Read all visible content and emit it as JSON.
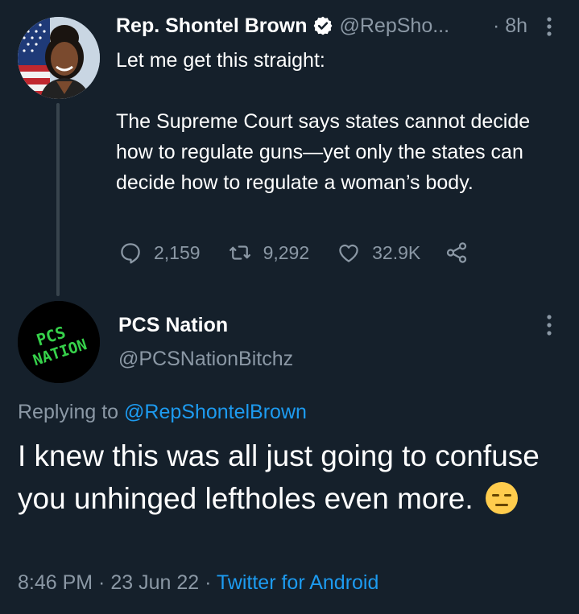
{
  "tweet1": {
    "author_name": "Rep. Shontel Brown",
    "handle": "@RepSho...",
    "time": "8h",
    "paragraphs": [
      "Let me get this straight:",
      "The Supreme Court says states cannot decide how to regulate guns—yet only the states can decide how to regulate a woman’s body."
    ],
    "replies": "2,159",
    "retweets": "9,292",
    "likes": "32.9K"
  },
  "tweet2": {
    "author_name": "PCS Nation",
    "handle": "@PCSNationBitchz",
    "avatar_text": [
      "PCS",
      "NATION"
    ],
    "replying_prefix": "Replying to",
    "replying_handle": "@RepShontelBrown",
    "text": "I knew this was all just going to confuse you unhinged leftholes even more.",
    "timestamp": "8:46 PM · 23 Jun 22 ·",
    "source": "Twitter for Android"
  },
  "colors": {
    "background": "#15202b",
    "muted": "#8b98a5",
    "link": "#1d9bf0",
    "thread_line": "#38444d",
    "avatar_text_green": "#36d14a"
  }
}
